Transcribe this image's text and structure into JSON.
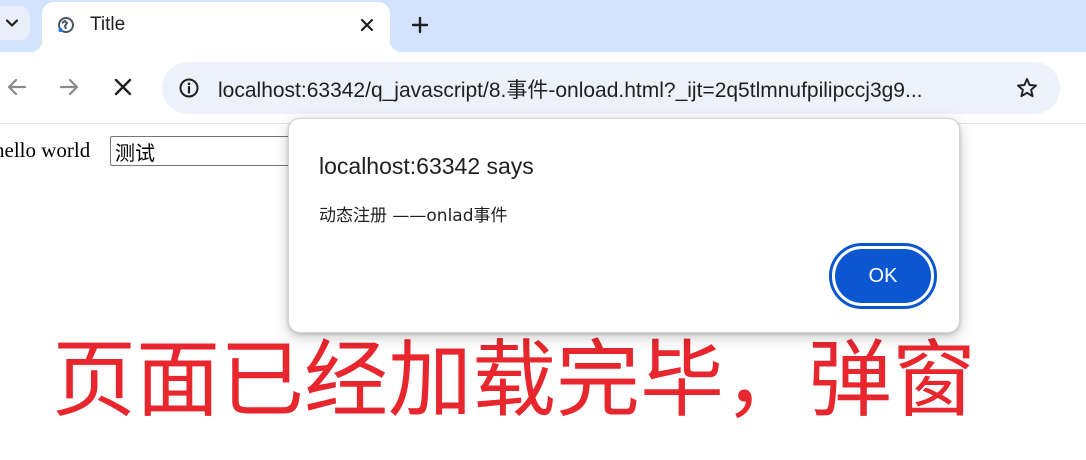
{
  "browser": {
    "tab": {
      "title": "Title",
      "favicon": "globe-icon"
    },
    "new_tab_icon": "plus-icon",
    "nav": {
      "back_icon": "back-arrow-icon",
      "forward_icon": "forward-arrow-icon",
      "stop_icon": "stop-loading-icon"
    },
    "omnibox": {
      "url": "localhost:63342/q_javascript/8.事件-onload.html?_ijt=2q5tlmnufpilipccj3g9...",
      "site_info_icon": "info-icon",
      "bookmark_icon": "star-icon"
    },
    "colors": {
      "tabstrip_bg": "#d3e3fd",
      "omnibox_bg": "#edf1f9",
      "accent": "#0b57d0"
    }
  },
  "page": {
    "text": "hello world",
    "input_value": "测试"
  },
  "dialog": {
    "title": "localhost:63342 says",
    "message": "动态注册 ——onlad事件",
    "ok_label": "OK"
  },
  "annotation": {
    "text": "页面已经加载完毕，弹窗",
    "color": "#e8262d"
  }
}
